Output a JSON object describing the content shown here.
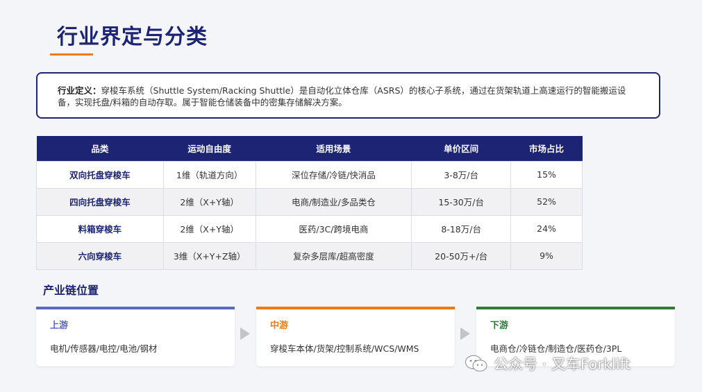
{
  "page": {
    "title": "行业界定与分类"
  },
  "definition": {
    "label": "行业定义：",
    "text": "穿梭车系统（Shuttle System/Racking Shuttle）是自动化立体仓库（ASRS）的核心子系统，通过在货架轨道上高速运行的智能搬运设备，实现托盘/料箱的自动存取。属于智能仓储装备中的密集存储解决方案。"
  },
  "table": {
    "headers": [
      "品类",
      "运动自由度",
      "适用场景",
      "单价区间",
      "市场占比"
    ],
    "rows": [
      [
        "双向托盘穿梭车",
        "1维（轨道方向）",
        "深位存储/冷链/快消品",
        "3-8万/台",
        "15%"
      ],
      [
        "四向托盘穿梭车",
        "2维（X+Y轴）",
        "电商/制造业/多品类仓",
        "15-30万/台",
        "52%"
      ],
      [
        "料箱穿梭车",
        "2维（X+Y轴）",
        "医药/3C/跨境电商",
        "8-18万/台",
        "24%"
      ],
      [
        "六向穿梭车",
        "3维（X+Y+Z轴）",
        "复杂多层库/超高密度",
        "20-50万+/台",
        "9%"
      ]
    ]
  },
  "chain": {
    "title": "产业链位置",
    "upstream": {
      "title": "上游",
      "body": "电机/传感器/电控/电池/钢材",
      "color": "#5b68c0"
    },
    "midstream": {
      "title": "中游",
      "body": "穿梭车本体/货架/控制系统/WCS/WMS",
      "color": "#f07a10"
    },
    "downstream": {
      "title": "下游",
      "body": "电商仓/冷链仓/制造仓/医药仓/3PL",
      "color": "#2e7d32"
    }
  },
  "watermark": {
    "text": "公众号 · 叉车Forklift"
  },
  "colors": {
    "primary": "#1c2473",
    "accent": "#f07a10"
  }
}
